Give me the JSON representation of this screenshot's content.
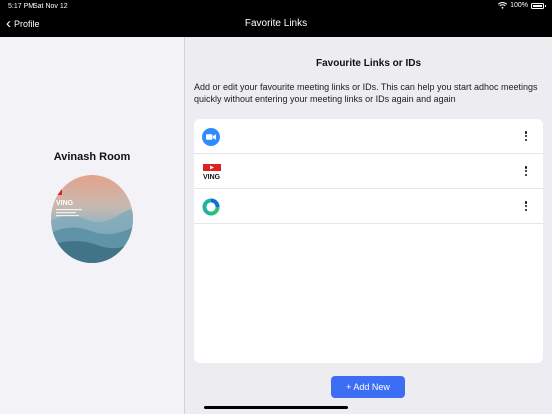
{
  "status_bar": {
    "time": "5:17 PM",
    "date": "Sat Nov 12",
    "battery": "100%",
    "battery_level": 1.0
  },
  "nav": {
    "back_label": "Profile",
    "title": "Favorite Links"
  },
  "left": {
    "room_name": "Avinash Room",
    "avatar_text": "VING"
  },
  "main": {
    "section_title": "Favourite Links or IDs",
    "description": "Add or edit your favourite meeting links or IDs. This can help you start adhoc meetings quickly without entering your meeting links or IDs again and again",
    "links": [
      {
        "icon": "zoom-icon",
        "color": "#2d8cff"
      },
      {
        "icon": "ving-icon",
        "label": "VING",
        "color": "#e02020"
      },
      {
        "icon": "webex-icon",
        "color": "#1fb3a2"
      }
    ],
    "add_button": "+ Add New"
  }
}
